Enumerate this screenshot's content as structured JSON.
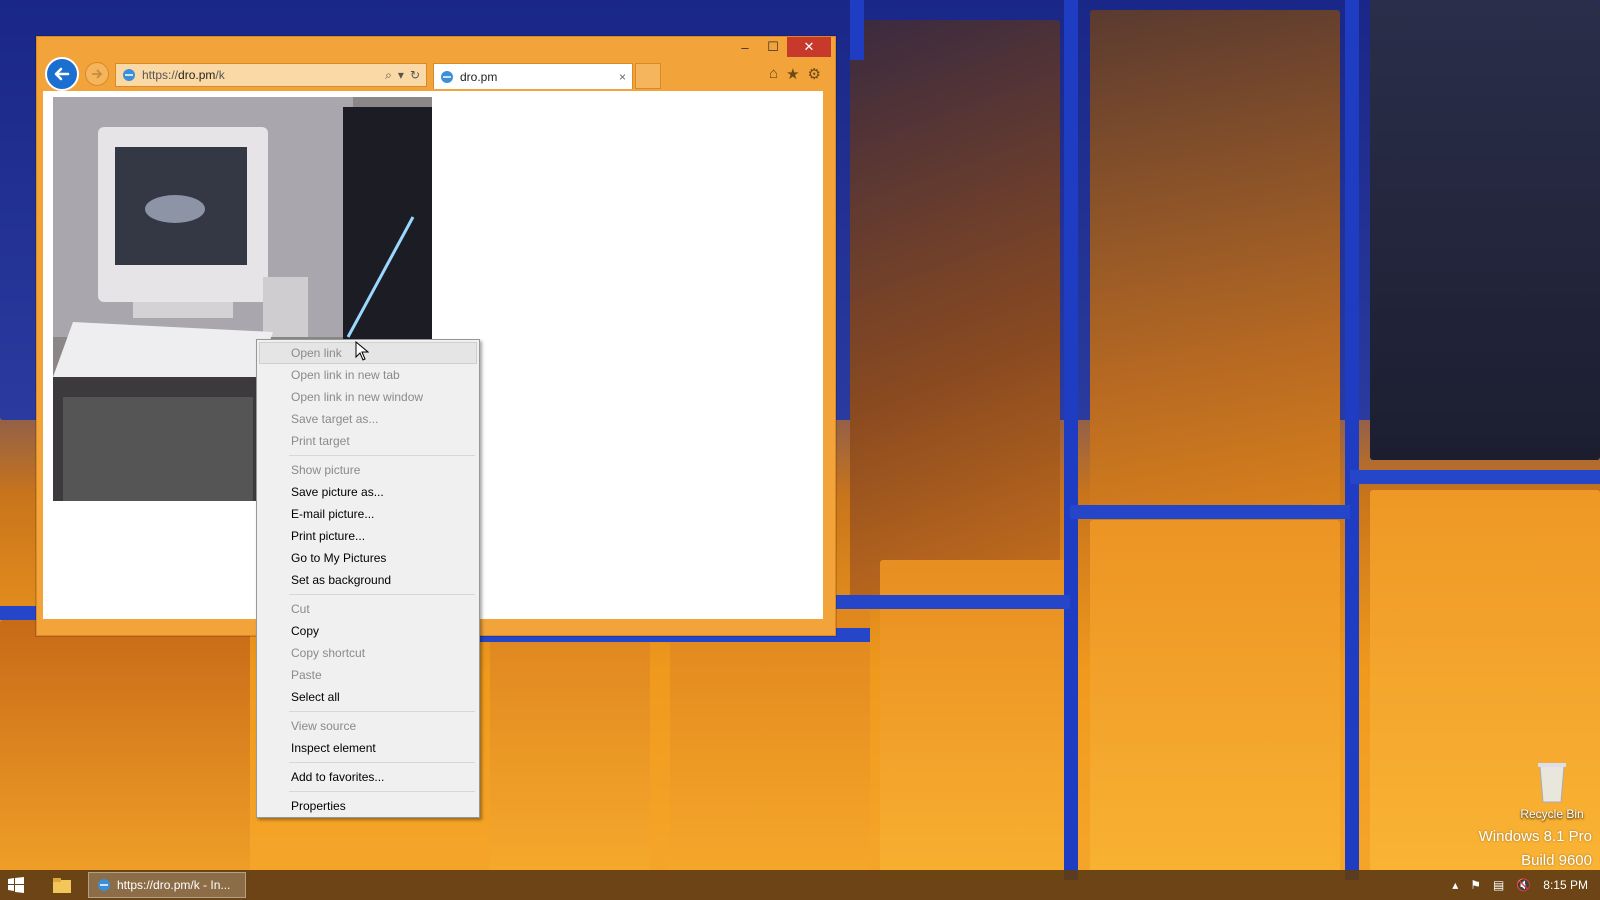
{
  "browser": {
    "address": {
      "prefix": "https://",
      "host": "dro.pm",
      "path": "/k"
    },
    "tab": {
      "title": "dro.pm",
      "close": "×"
    },
    "caption": {
      "minimize": "–",
      "maximize": "☐",
      "close": "✕"
    }
  },
  "context_menu": {
    "items": [
      {
        "label": "Open link",
        "disabled": true,
        "hover": true
      },
      {
        "label": "Open link in new tab",
        "disabled": true
      },
      {
        "label": "Open link in new window",
        "disabled": true
      },
      {
        "label": "Save target as...",
        "disabled": true
      },
      {
        "label": "Print target",
        "disabled": true
      },
      {
        "label": "Show picture",
        "disabled": true
      },
      {
        "label": "Save picture as...",
        "disabled": false
      },
      {
        "label": "E-mail picture...",
        "disabled": false
      },
      {
        "label": "Print picture...",
        "disabled": false
      },
      {
        "label": "Go to My Pictures",
        "disabled": false
      },
      {
        "label": "Set as background",
        "disabled": false
      },
      {
        "label": "Cut",
        "disabled": true
      },
      {
        "label": "Copy",
        "disabled": false
      },
      {
        "label": "Copy shortcut",
        "disabled": true
      },
      {
        "label": "Paste",
        "disabled": true
      },
      {
        "label": "Select all",
        "disabled": false
      },
      {
        "label": "View source",
        "disabled": true
      },
      {
        "label": "Inspect element",
        "disabled": false
      },
      {
        "label": "Add to favorites...",
        "disabled": false
      },
      {
        "label": "Properties",
        "disabled": false
      }
    ]
  },
  "desktop": {
    "recycle_bin": "Recycle Bin",
    "os_name": "Windows 8.1 Pro",
    "build": "Build 9600"
  },
  "taskbar": {
    "task_label": "https://dro.pm/k - In...",
    "clock": "8:15 PM"
  },
  "colors": {
    "window_frame": "#f2a33a",
    "back_button": "#1b6fd0",
    "close_button": "#c7392b"
  }
}
